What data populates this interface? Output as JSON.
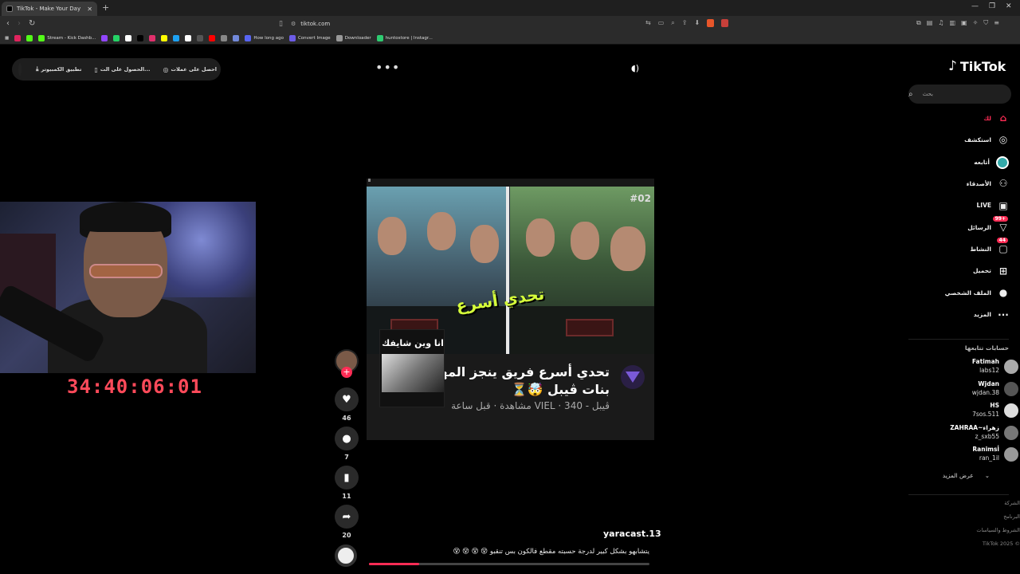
{
  "browser": {
    "tab_title": "TikTok - Make Your Day",
    "new_tab": "+",
    "url": "tiktok.com",
    "bookmarks": [
      {
        "label": "",
        "color": "#e0245e"
      },
      {
        "label": "",
        "color": "#53fc18"
      },
      {
        "label": "Stream - Kick Dashb...",
        "color": "#53fc18"
      },
      {
        "label": "",
        "color": "#9146ff"
      },
      {
        "label": "",
        "color": "#25d366"
      },
      {
        "label": "",
        "color": "#ffffff"
      },
      {
        "label": "",
        "color": "#000000"
      },
      {
        "label": "",
        "color": "#e1306c"
      },
      {
        "label": "",
        "color": "#fffc00"
      },
      {
        "label": "",
        "color": "#1da1f2"
      },
      {
        "label": "",
        "color": "#ffffff"
      },
      {
        "label": "",
        "color": "#555555"
      },
      {
        "label": "",
        "color": "#ff0000"
      },
      {
        "label": "",
        "color": "#888888"
      },
      {
        "label": "",
        "color": "#7289da"
      },
      {
        "label": "How long ago",
        "color": "#5865f2"
      },
      {
        "label": "Convert Image",
        "color": "#6c5ce7"
      },
      {
        "label": "Downloader",
        "color": "#999999"
      },
      {
        "label": "huntostore | Instagr...",
        "color": "#2ecc71"
      }
    ]
  },
  "top_pill": {
    "coins": "احصل على عملات",
    "get_app": "الحصول على الت...",
    "desktop_app": "تطبيق الكمبيوتر"
  },
  "overlay": {
    "countdown": "34:40:06:01"
  },
  "video": {
    "episode": "#02",
    "thumb_title": "تحدي أسرع",
    "card_title": "تحدي أسرع فريق ينجز المهام - بنات ڤيبل 🤯⏳",
    "card_meta": "ڤيبل - VIEL · 340 مشاهدة · قبل ساعة",
    "sticker_text": "انا وين شايفك",
    "author": "yaracast.13",
    "caption": "يتشابهو بشكل كبير لدرجة حسبته مقطع فالكون بس تنقبو 😵 😵 😵 😵",
    "progress": 0.18
  },
  "actions": {
    "likes": "46",
    "comments": "7",
    "saves": "11",
    "shares": "20"
  },
  "sidebar": {
    "logo": "TikTok",
    "search_placeholder": "بحث",
    "nav": [
      {
        "label": "لك",
        "icon": "home-icon"
      },
      {
        "label": "استكشف",
        "icon": "compass-icon"
      },
      {
        "label": "أتابعه",
        "icon": "following-avatar"
      },
      {
        "label": "الأصدقاء",
        "icon": "friends-icon"
      },
      {
        "label": "LIVE",
        "icon": "live-icon"
      },
      {
        "label": "الرسائل",
        "icon": "messages-icon",
        "badge": "99+"
      },
      {
        "label": "النشاط",
        "icon": "activity-icon",
        "badge": "44"
      },
      {
        "label": "تحميل",
        "icon": "upload-icon"
      },
      {
        "label": "الملف الشخصي",
        "icon": "profile-icon"
      },
      {
        "label": "المزيد",
        "icon": "more-icon"
      }
    ],
    "following_header": "حسابات تتابعها",
    "following": [
      {
        "name": "Fatimah",
        "user": "labs12"
      },
      {
        "name": "Wjdan",
        "user": "wjdan.38"
      },
      {
        "name": "HS",
        "user": "7sos.511"
      },
      {
        "name": "ZAHRAA~زهراء",
        "user": "z_sxb55"
      },
      {
        "name": "Ranimsأ",
        "user": "ran_1il"
      }
    ],
    "see_more": "عرض المزيد",
    "footer": [
      "الشركة",
      "البرنامج",
      "الشروط والسياسات",
      "TikTok 2025 ©"
    ]
  }
}
